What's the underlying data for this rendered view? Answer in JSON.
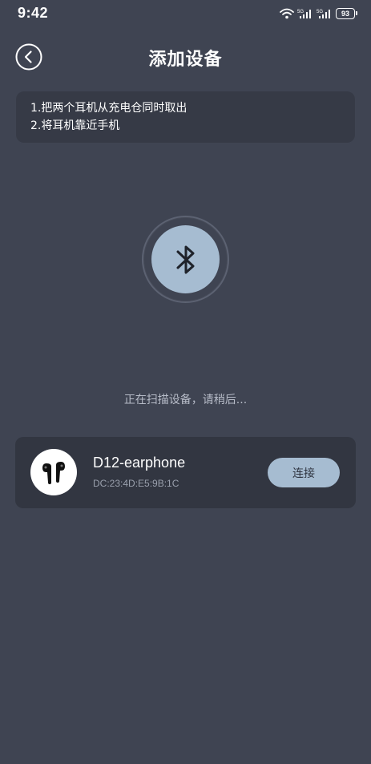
{
  "status_bar": {
    "time": "9:42",
    "battery": "93",
    "icons": [
      "wifi-icon",
      "signal-5g-icon",
      "signal-5g-icon",
      "battery-icon"
    ]
  },
  "header": {
    "title": "添加设备",
    "back_icon": "back-icon"
  },
  "tips": {
    "line1": "1.把两个耳机从充电仓同时取出",
    "line2": "2.将耳机靠近手机"
  },
  "scan": {
    "icon": "bluetooth-icon",
    "status": "正在扫描设备，请稍后..."
  },
  "device": {
    "icon": "earphone-icon",
    "name": "D12-earphone",
    "mac": "DC:23:4D:E5:9B:1C",
    "connect_label": "连接"
  },
  "colors": {
    "background": "#3f4452",
    "card": "#363a46",
    "accent": "#a6bcd1"
  }
}
